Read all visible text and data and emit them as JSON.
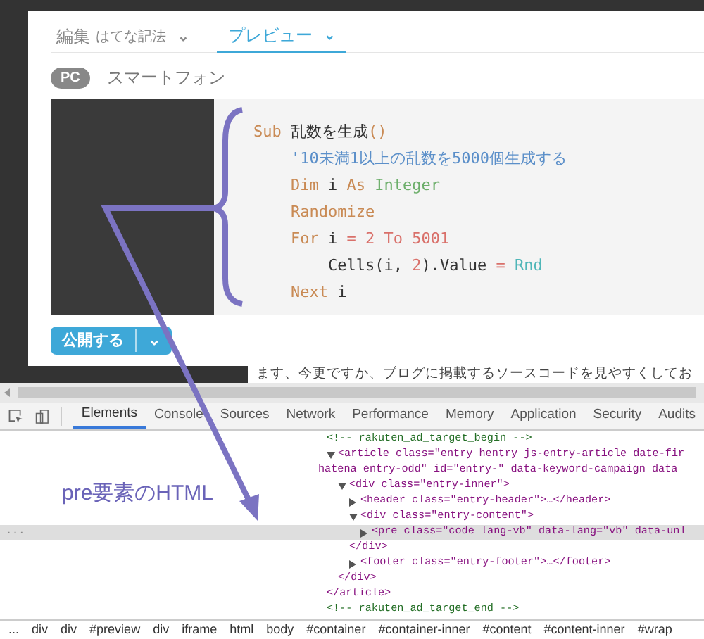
{
  "editor_tabs": [
    {
      "label": "編集",
      "sublabel": "はてな記法",
      "caret": "⌄",
      "selected": false
    },
    {
      "label": "プレビュー",
      "caret": "⌄",
      "selected": true
    }
  ],
  "device_tabs": [
    {
      "label": "PC",
      "selected": true
    },
    {
      "label": "スマートフォン",
      "selected": false
    }
  ],
  "code_lines": [
    [
      {
        "text": "Sub ",
        "kind": "keyword"
      },
      {
        "text": "乱数を生成",
        "kind": "plain"
      },
      {
        "text": "()",
        "kind": "keyword"
      }
    ],
    [
      {
        "text": "    '10未満1以上の乱数を5000個生成する",
        "kind": "comment"
      }
    ],
    [
      {
        "text": "    Dim ",
        "kind": "keyword"
      },
      {
        "text": "i ",
        "kind": "plain"
      },
      {
        "text": "As ",
        "kind": "keyword"
      },
      {
        "text": "Integer",
        "kind": "type"
      }
    ],
    [
      {
        "text": "    Randomize",
        "kind": "keyword"
      }
    ],
    [
      {
        "text": "    For ",
        "kind": "keyword"
      },
      {
        "text": "i ",
        "kind": "plain"
      },
      {
        "text": "= 2 To 5001",
        "kind": "number"
      }
    ],
    [
      {
        "text": "        Cells(i, ",
        "kind": "plain"
      },
      {
        "text": "2",
        "kind": "number"
      },
      {
        "text": ").Value ",
        "kind": "plain"
      },
      {
        "text": "= ",
        "kind": "number"
      },
      {
        "text": "Rnd",
        "kind": "func"
      }
    ],
    [
      {
        "text": "    Next ",
        "kind": "keyword"
      },
      {
        "text": "i",
        "kind": "plain"
      }
    ]
  ],
  "publish_button": {
    "label": "公開する",
    "caret": "⌄"
  },
  "page_text": "ます、今更ですか、ブログに掲載するソースコードを見やすくしてお",
  "devtools_tabs": [
    {
      "label": "Elements",
      "selected": true
    },
    {
      "label": "Console",
      "selected": false
    },
    {
      "label": "Sources",
      "selected": false
    },
    {
      "label": "Network",
      "selected": false
    },
    {
      "label": "Performance",
      "selected": false
    },
    {
      "label": "Memory",
      "selected": false
    },
    {
      "label": "Application",
      "selected": false
    },
    {
      "label": "Security",
      "selected": false
    },
    {
      "label": "Audits",
      "selected": false
    }
  ],
  "dom_tree": [
    {
      "text": "<!-- rakuten_ad_target_begin -->",
      "kind": "comment",
      "selected": false
    },
    {
      "text": "<article class=\"entry hentry js-entry-article date-fir",
      "continuation": "hatena entry-odd\" id=\"entry-\" data-keyword-campaign data",
      "kind": "tag",
      "expanded": true,
      "selected": false,
      "children": [
        {
          "text": "<div class=\"entry-inner\">",
          "kind": "tag",
          "expanded": true,
          "selected": false,
          "children": [
            {
              "text": "<header class=\"entry-header\">…</header>",
              "kind": "tag",
              "expanded": false,
              "selected": false
            },
            {
              "text": "<div class=\"entry-content\">",
              "kind": "tag",
              "expanded": true,
              "selected": false,
              "children": [
                {
                  "text": "<pre class=\"code lang-vb\" data-lang=\"vb\" data-unl",
                  "kind": "tag",
                  "expanded": false,
                  "selected": true
                }
              ]
            },
            {
              "text": "</div>",
              "kind": "tag",
              "selected": false
            },
            {
              "text": "<footer class=\"entry-footer\">…</footer>",
              "kind": "tag",
              "expanded": false,
              "selected": false
            }
          ]
        },
        {
          "text": "</div>",
          "kind": "tag",
          "selected": false
        }
      ]
    },
    {
      "text": "</article>",
      "kind": "tag",
      "selected": false
    },
    {
      "text": "<!-- rakuten_ad_target_end -->",
      "kind": "comment",
      "selected": false
    }
  ],
  "row_ellipsis": "...",
  "breadcrumbs": [
    "...",
    "div",
    "div",
    "#preview",
    "div",
    "iframe",
    "html",
    "body",
    "#container",
    "#container-inner",
    "#content",
    "#content-inner",
    "#wrap"
  ],
  "annotation": {
    "label": "pre要素のHTML"
  }
}
